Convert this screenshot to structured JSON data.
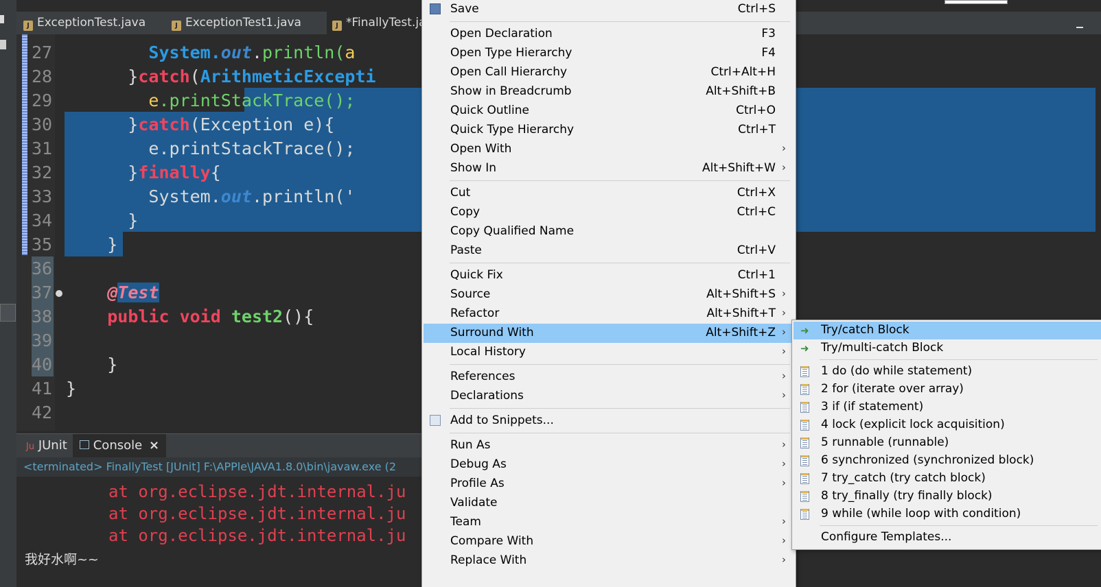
{
  "editor": {
    "tabs": [
      {
        "label": "ExceptionTest.java"
      },
      {
        "label": "ExceptionTest1.java"
      },
      {
        "label": "*FinallyTest.ja"
      }
    ],
    "line_numbers": [
      "27",
      "28",
      "29",
      "30",
      "31",
      "32",
      "33",
      "34",
      "35",
      "36",
      "37",
      "38",
      "39",
      "40",
      "41",
      "42"
    ],
    "code_lines": [
      {
        "parts": [
          {
            "t": "        System.",
            "c": "cls"
          },
          {
            "t": "out",
            "c": "it"
          },
          {
            "t": ".",
            "c": "pl"
          },
          {
            "t": "println(",
            "c": "fn"
          },
          {
            "t": "a",
            "c": "var"
          }
        ]
      },
      {
        "parts": [
          {
            "t": "      }",
            "c": "pl"
          },
          {
            "t": "catch",
            "c": "kw"
          },
          {
            "t": "(",
            "c": "pl"
          },
          {
            "t": "ArithmeticExcepti",
            "c": "cls"
          }
        ]
      },
      {
        "parts": [
          {
            "t": "        ",
            "c": "pl"
          },
          {
            "t": "e",
            "c": "var"
          },
          {
            "t": ".pr",
            "c": "fn"
          },
          {
            "t": "intStackTrace();",
            "c": "fn"
          }
        ]
      },
      {
        "parts": [
          {
            "t": "      }",
            "c": "pl"
          },
          {
            "t": "catch",
            "c": "kw"
          },
          {
            "t": "(Exception e){",
            "c": "pl"
          }
        ]
      },
      {
        "parts": [
          {
            "t": "        e.printStackTrace();",
            "c": "pl"
          }
        ]
      },
      {
        "parts": [
          {
            "t": "      }",
            "c": "pl"
          },
          {
            "t": "finally",
            "c": "kw"
          },
          {
            "t": "{",
            "c": "pl"
          }
        ]
      },
      {
        "parts": [
          {
            "t": "        System.",
            "c": "pl"
          },
          {
            "t": "out",
            "c": "it"
          },
          {
            "t": ".println('",
            "c": "pl"
          }
        ]
      },
      {
        "parts": [
          {
            "t": "      }",
            "c": "pl"
          }
        ]
      },
      {
        "parts": [
          {
            "t": "    }",
            "c": "pl"
          }
        ]
      },
      {
        "parts": [
          {
            "t": "",
            "c": "pl"
          }
        ]
      },
      {
        "parts": [
          {
            "t": "    ",
            "c": "pl"
          },
          {
            "t": "@",
            "c": "ann"
          },
          {
            "t": "Test",
            "c": "anntag"
          }
        ]
      },
      {
        "parts": [
          {
            "t": "    ",
            "c": "pl"
          },
          {
            "t": "public void ",
            "c": "kw"
          },
          {
            "t": "test2",
            "c": "fnb"
          },
          {
            "t": "(){",
            "c": "pl"
          }
        ]
      },
      {
        "parts": [
          {
            "t": "",
            "c": "pl"
          }
        ]
      },
      {
        "parts": [
          {
            "t": "    }",
            "c": "pl"
          }
        ]
      },
      {
        "parts": [
          {
            "t": "}",
            "c": "pl"
          }
        ]
      },
      {
        "parts": [
          {
            "t": "",
            "c": "pl"
          }
        ]
      }
    ]
  },
  "console": {
    "tabs": [
      {
        "label": "JUnit"
      },
      {
        "label": "Console"
      }
    ],
    "status": "<terminated> FinallyTest [JUnit] F:\\APPle\\JAVA1.8.0\\bin\\javaw.exe (2",
    "lines": [
      "at org.eclipse.jdt.internal.ju",
      "at org.eclipse.jdt.internal.ju",
      "at org.eclipse.jdt.internal.ju"
    ],
    "output": "我好水啊~~"
  },
  "context_menu": {
    "items": [
      {
        "id": "save",
        "label": "Save",
        "shortcut": "Ctrl+S",
        "icon": "save-icon"
      },
      {
        "sep": true
      },
      {
        "id": "open-declaration",
        "label": "Open Declaration",
        "shortcut": "F3"
      },
      {
        "id": "open-type-hierarchy",
        "label": "Open Type Hierarchy",
        "shortcut": "F4"
      },
      {
        "id": "open-call-hierarchy",
        "label": "Open Call Hierarchy",
        "shortcut": "Ctrl+Alt+H"
      },
      {
        "id": "show-in-breadcrumb",
        "label": "Show in Breadcrumb",
        "shortcut": "Alt+Shift+B"
      },
      {
        "id": "quick-outline",
        "label": "Quick Outline",
        "shortcut": "Ctrl+O"
      },
      {
        "id": "quick-type-hierarchy",
        "label": "Quick Type Hierarchy",
        "shortcut": "Ctrl+T"
      },
      {
        "id": "open-with",
        "label": "Open With",
        "submenu": true
      },
      {
        "id": "show-in",
        "label": "Show In",
        "shortcut": "Alt+Shift+W",
        "submenu": true
      },
      {
        "sep": true
      },
      {
        "id": "cut",
        "label": "Cut",
        "shortcut": "Ctrl+X"
      },
      {
        "id": "copy",
        "label": "Copy",
        "shortcut": "Ctrl+C"
      },
      {
        "id": "copy-qualified-name",
        "label": "Copy Qualified Name"
      },
      {
        "id": "paste",
        "label": "Paste",
        "shortcut": "Ctrl+V"
      },
      {
        "sep": true
      },
      {
        "id": "quick-fix",
        "label": "Quick Fix",
        "shortcut": "Ctrl+1"
      },
      {
        "id": "source",
        "label": "Source",
        "shortcut": "Alt+Shift+S",
        "submenu": true
      },
      {
        "id": "refactor",
        "label": "Refactor",
        "shortcut": "Alt+Shift+T",
        "submenu": true
      },
      {
        "id": "surround-with",
        "label": "Surround With",
        "shortcut": "Alt+Shift+Z",
        "submenu": true,
        "hot": true
      },
      {
        "id": "local-history",
        "label": "Local History",
        "submenu": true
      },
      {
        "sep": true
      },
      {
        "id": "references",
        "label": "References",
        "submenu": true
      },
      {
        "id": "declarations",
        "label": "Declarations",
        "submenu": true
      },
      {
        "sep": true
      },
      {
        "id": "add-to-snippets",
        "label": "Add to Snippets...",
        "icon": "snippets-icon"
      },
      {
        "sep": true
      },
      {
        "id": "run-as",
        "label": "Run As",
        "submenu": true
      },
      {
        "id": "debug-as",
        "label": "Debug As",
        "submenu": true
      },
      {
        "id": "profile-as",
        "label": "Profile As",
        "submenu": true
      },
      {
        "id": "validate",
        "label": "Validate"
      },
      {
        "id": "team",
        "label": "Team",
        "submenu": true
      },
      {
        "id": "compare-with",
        "label": "Compare With",
        "submenu": true
      },
      {
        "id": "replace-with",
        "label": "Replace With",
        "submenu": true
      }
    ]
  },
  "surround_submenu": {
    "items": [
      {
        "id": "try-catch",
        "label": "Try/catch Block",
        "icon": "arrow",
        "hot": true
      },
      {
        "id": "try-multi-catch",
        "label": "Try/multi-catch Block",
        "icon": "arrow"
      },
      {
        "sep": true
      },
      {
        "id": "tpl-do",
        "label": "1 do (do while statement)",
        "icon": "template"
      },
      {
        "id": "tpl-for",
        "label": "2 for (iterate over array)",
        "icon": "template"
      },
      {
        "id": "tpl-if",
        "label": "3 if (if statement)",
        "icon": "template"
      },
      {
        "id": "tpl-lock",
        "label": "4 lock (explicit lock acquisition)",
        "icon": "template"
      },
      {
        "id": "tpl-runnable",
        "label": "5 runnable (runnable)",
        "icon": "template"
      },
      {
        "id": "tpl-synchronized",
        "label": "6 synchronized (synchronized block)",
        "icon": "template"
      },
      {
        "id": "tpl-try-catch",
        "label": "7 try_catch (try catch block)",
        "icon": "template"
      },
      {
        "id": "tpl-try-finally",
        "label": "8 try_finally (try finally block)",
        "icon": "template"
      },
      {
        "id": "tpl-while",
        "label": "9 while (while loop with condition)",
        "icon": "template"
      },
      {
        "sep": true
      },
      {
        "id": "configure-templates",
        "label": "Configure Templates..."
      }
    ]
  }
}
